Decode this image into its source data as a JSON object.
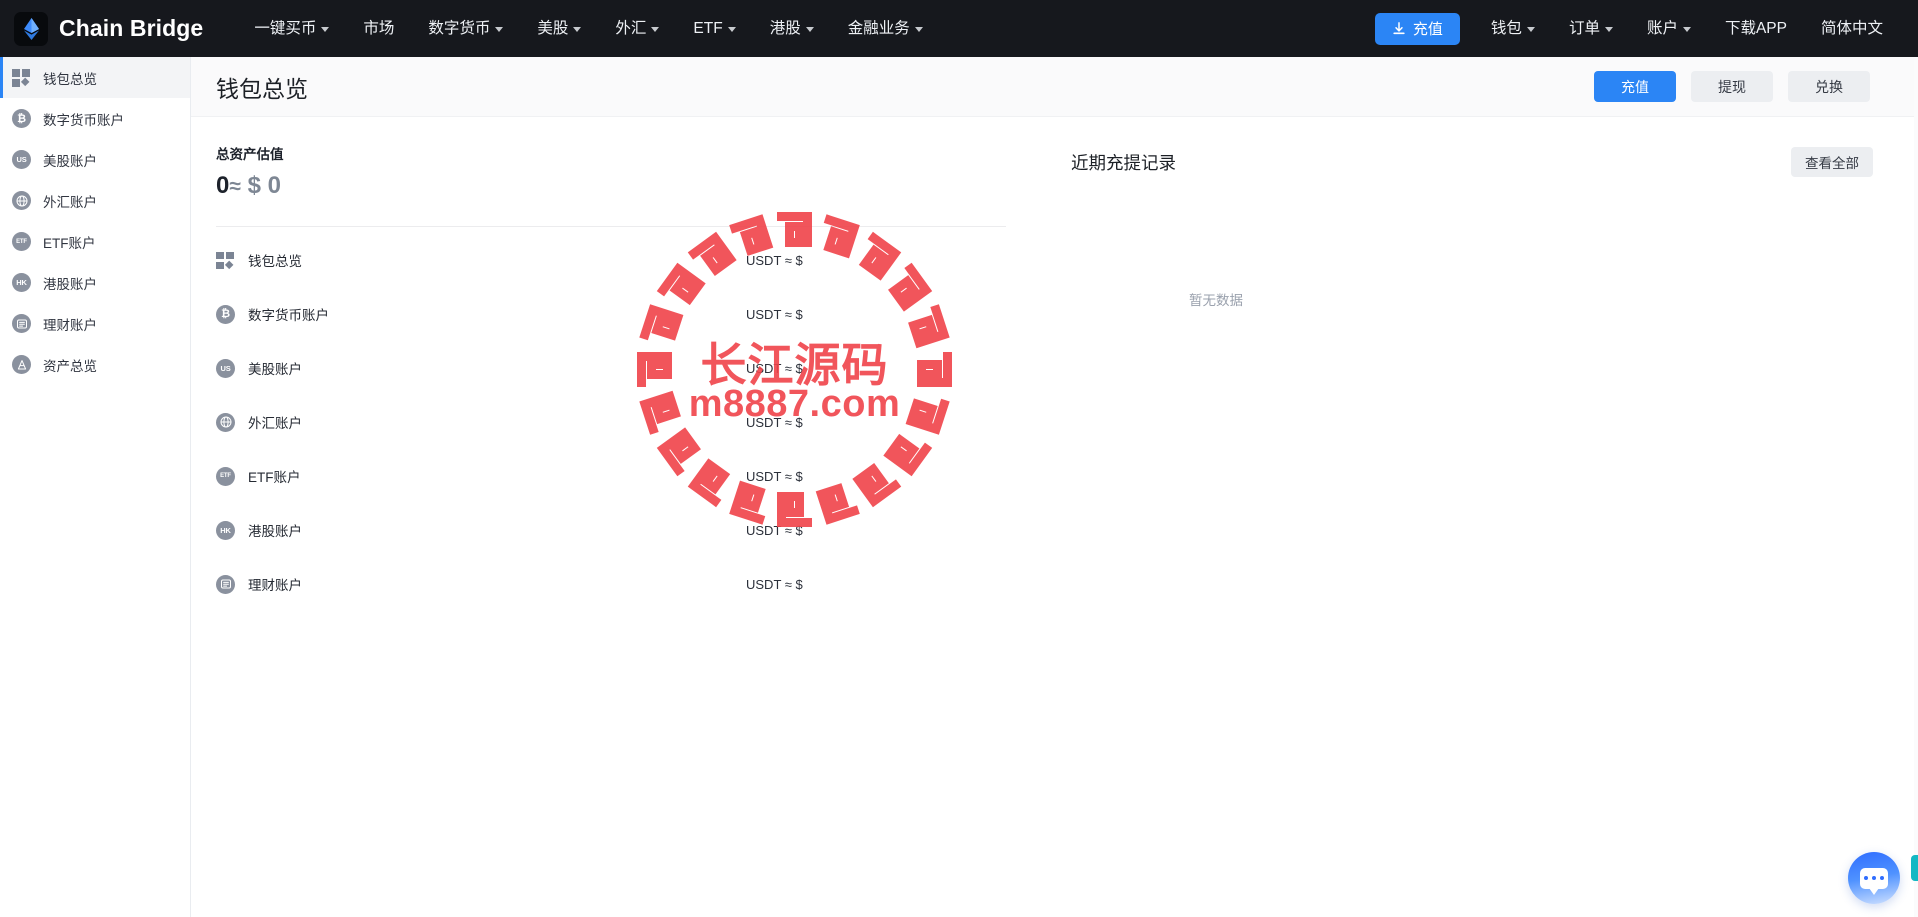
{
  "brand": {
    "name": "Chain Bridge",
    "logo_icon": "ethereum-diamond-icon"
  },
  "topnav": {
    "items": [
      {
        "label": "一键买币",
        "caret": true
      },
      {
        "label": "市场",
        "caret": false
      },
      {
        "label": "数字货币",
        "caret": true
      },
      {
        "label": "美股",
        "caret": true
      },
      {
        "label": "外汇",
        "caret": true
      },
      {
        "label": "ETF",
        "caret": true
      },
      {
        "label": "港股",
        "caret": true
      },
      {
        "label": "金融业务",
        "caret": true
      }
    ],
    "topup_button": "充值",
    "topup_icon": "download-icon",
    "right_items": [
      {
        "label": "钱包",
        "caret": true
      },
      {
        "label": "订单",
        "caret": true
      },
      {
        "label": "账户",
        "caret": true
      },
      {
        "label": "下载APP",
        "caret": false
      },
      {
        "label": "简体中文",
        "caret": false
      }
    ]
  },
  "sidebar": {
    "items": [
      {
        "label": "钱包总览",
        "icon": "grid-icon",
        "active": true
      },
      {
        "label": "数字货币账户",
        "icon": "bitcoin-icon",
        "active": false
      },
      {
        "label": "美股账户",
        "icon": "us-icon",
        "active": false
      },
      {
        "label": "外汇账户",
        "icon": "forex-globe-icon",
        "active": false
      },
      {
        "label": "ETF账户",
        "icon": "etf-icon",
        "active": false
      },
      {
        "label": "港股账户",
        "icon": "hk-icon",
        "active": false
      },
      {
        "label": "理财账户",
        "icon": "finance-icon",
        "active": false
      },
      {
        "label": "资产总览",
        "icon": "asset-icon",
        "active": false
      }
    ]
  },
  "page": {
    "title": "钱包总览",
    "actions": [
      {
        "label": "充值",
        "style": "primary"
      },
      {
        "label": "提现",
        "style": "ghost"
      },
      {
        "label": "兑换",
        "style": "ghost"
      }
    ]
  },
  "assets": {
    "label": "总资产估值",
    "amount": "0",
    "approx_symbol": "≈",
    "usd_value": "$ 0"
  },
  "accounts": {
    "rows": [
      {
        "label": "钱包总览",
        "icon": "grid-icon",
        "amount": "USDT ≈ $"
      },
      {
        "label": "数字货币账户",
        "icon": "bitcoin-icon",
        "amount": "USDT ≈ $"
      },
      {
        "label": "美股账户",
        "icon": "us-icon",
        "amount": "USDT ≈ $"
      },
      {
        "label": "外汇账户",
        "icon": "forex-globe-icon",
        "amount": "USDT ≈ $"
      },
      {
        "label": "ETF账户",
        "icon": "etf-icon",
        "amount": "USDT ≈ $"
      },
      {
        "label": "港股账户",
        "icon": "hk-icon",
        "amount": "USDT ≈ $"
      },
      {
        "label": "理财账户",
        "icon": "finance-icon",
        "amount": "USDT ≈ $"
      }
    ]
  },
  "records": {
    "title": "近期充提记录",
    "view_all": "查看全部",
    "empty_text": "暂无数据"
  },
  "watermark": {
    "text_cn": "长江源码",
    "text_url": "m8887.com",
    "color": "#f0434a"
  },
  "chat": {
    "icon": "chat-bubble-icon"
  },
  "colors": {
    "nav_bg": "#16181d",
    "accent": "#2b85f5",
    "ghost_btn": "#eceef1",
    "token_gray": "#8a919e"
  }
}
